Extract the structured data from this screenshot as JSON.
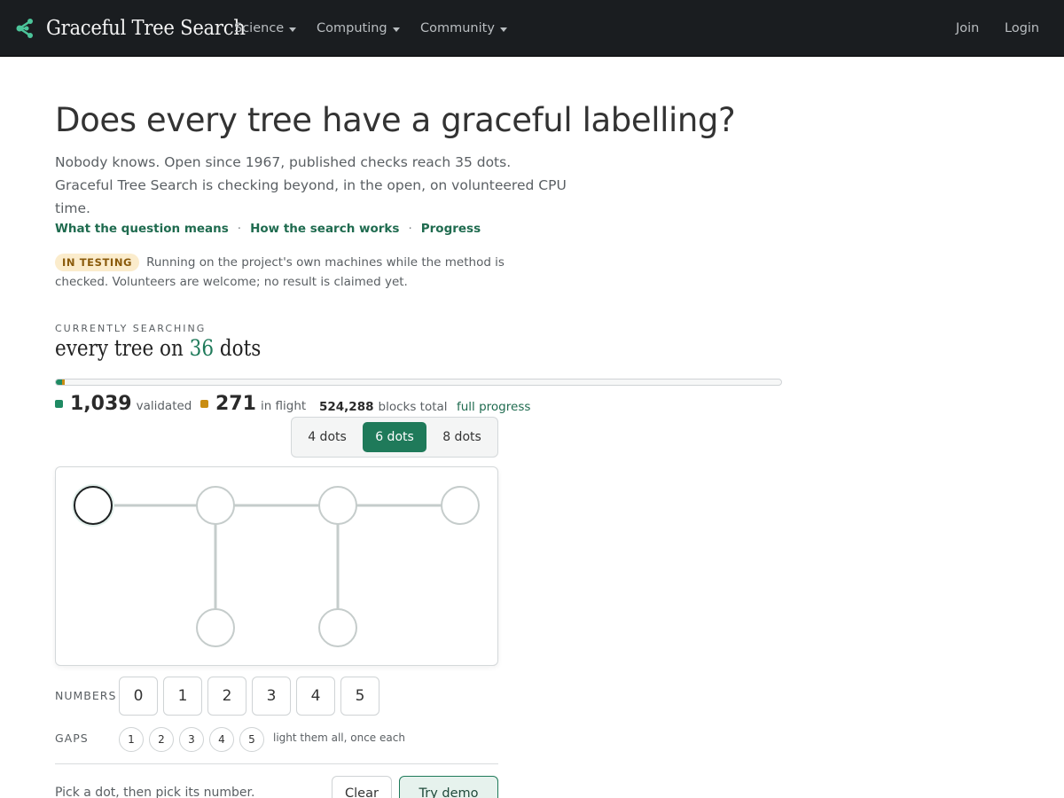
{
  "navbar": {
    "brand": "Graceful Tree Search",
    "menus": [
      {
        "label": "Science"
      },
      {
        "label": "Computing"
      },
      {
        "label": "Community"
      }
    ],
    "join": "Join",
    "login": "Login"
  },
  "hero": {
    "headline": "Does every tree have a graceful labelling?",
    "lead": "Nobody knows. Open since 1967, published checks reach 35 dots. Graceful Tree Search is checking beyond, in the open, on volunteered CPU time.",
    "links": [
      "What the question means",
      "How the search works",
      "Progress"
    ],
    "separator": "·"
  },
  "status": {
    "badge": "IN TESTING",
    "text": "Running on the project's own machines while the method is checked. Volunteers are welcome; no result is claimed yet."
  },
  "search": {
    "kicker": "CURRENTLY SEARCHING",
    "prefix": "every tree on",
    "dots": "36",
    "suffix": "dots",
    "progress": {
      "validated_fraction": 0.00198,
      "in_flight_fraction": 0.00052
    },
    "validated_count": "1,039",
    "validated_label": "validated",
    "in_flight_count": "271",
    "in_flight_label": "in flight",
    "total_count": "524,288",
    "total_label": "blocks total",
    "full_progress_link": "full progress",
    "colors": {
      "validated": "#1f8a63",
      "in_flight": "#c98d12"
    }
  },
  "puzzle": {
    "size_options": [
      "4 dots",
      "6 dots",
      "8 dots"
    ],
    "selected_size": "6 dots",
    "numbers_label": "NUMBERS",
    "numbers": [
      "0",
      "1",
      "2",
      "3",
      "4",
      "5"
    ],
    "gaps_label": "GAPS",
    "gaps": [
      "1",
      "2",
      "3",
      "4",
      "5"
    ],
    "gaps_hint": "light them all, once each",
    "instruction": "Pick a dot, then pick its number.",
    "clear_button": "Clear",
    "demo_button": "Try demo"
  }
}
